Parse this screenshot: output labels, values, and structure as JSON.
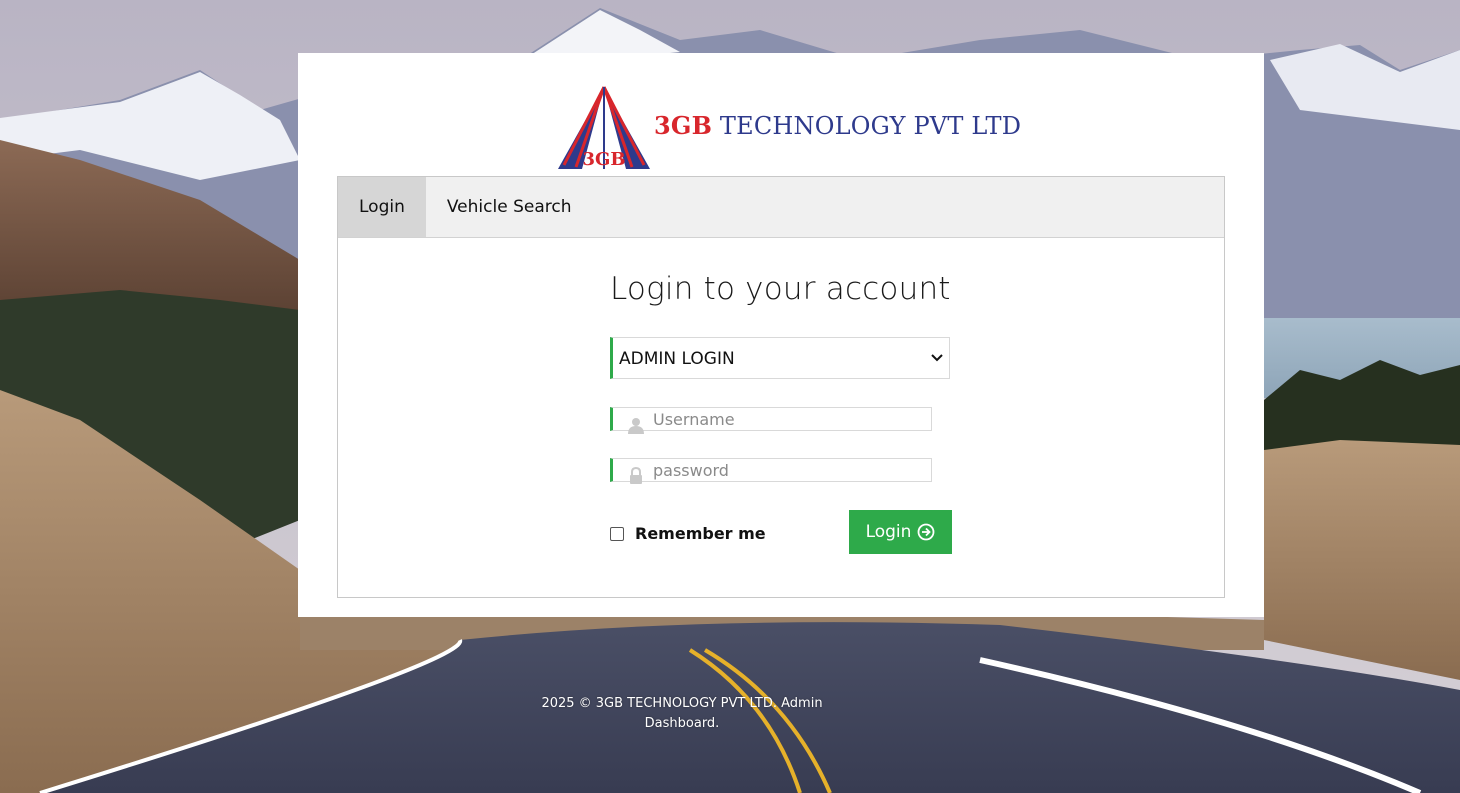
{
  "brand": {
    "logo_monogram": "3GB",
    "name_prefix": "3GB",
    "name_suffix": " TECHNOLOGY PVT LTD"
  },
  "tabs": [
    {
      "label": "Login",
      "active": true
    },
    {
      "label": "Vehicle Search",
      "active": false
    }
  ],
  "form": {
    "title": "Login to your account",
    "login_type": {
      "selected": "ADMIN LOGIN"
    },
    "username": {
      "placeholder": "Username",
      "value": ""
    },
    "password": {
      "placeholder": "password",
      "value": ""
    },
    "remember_label": "Remember me",
    "remember_checked": false,
    "submit_label": "Login"
  },
  "footer": {
    "text": "2025 © 3GB TECHNOLOGY PVT LTD. Admin Dashboard."
  },
  "colors": {
    "accent_green": "#2eaa4a",
    "brand_blue": "#2e3a8c",
    "brand_red": "#d8262c"
  }
}
